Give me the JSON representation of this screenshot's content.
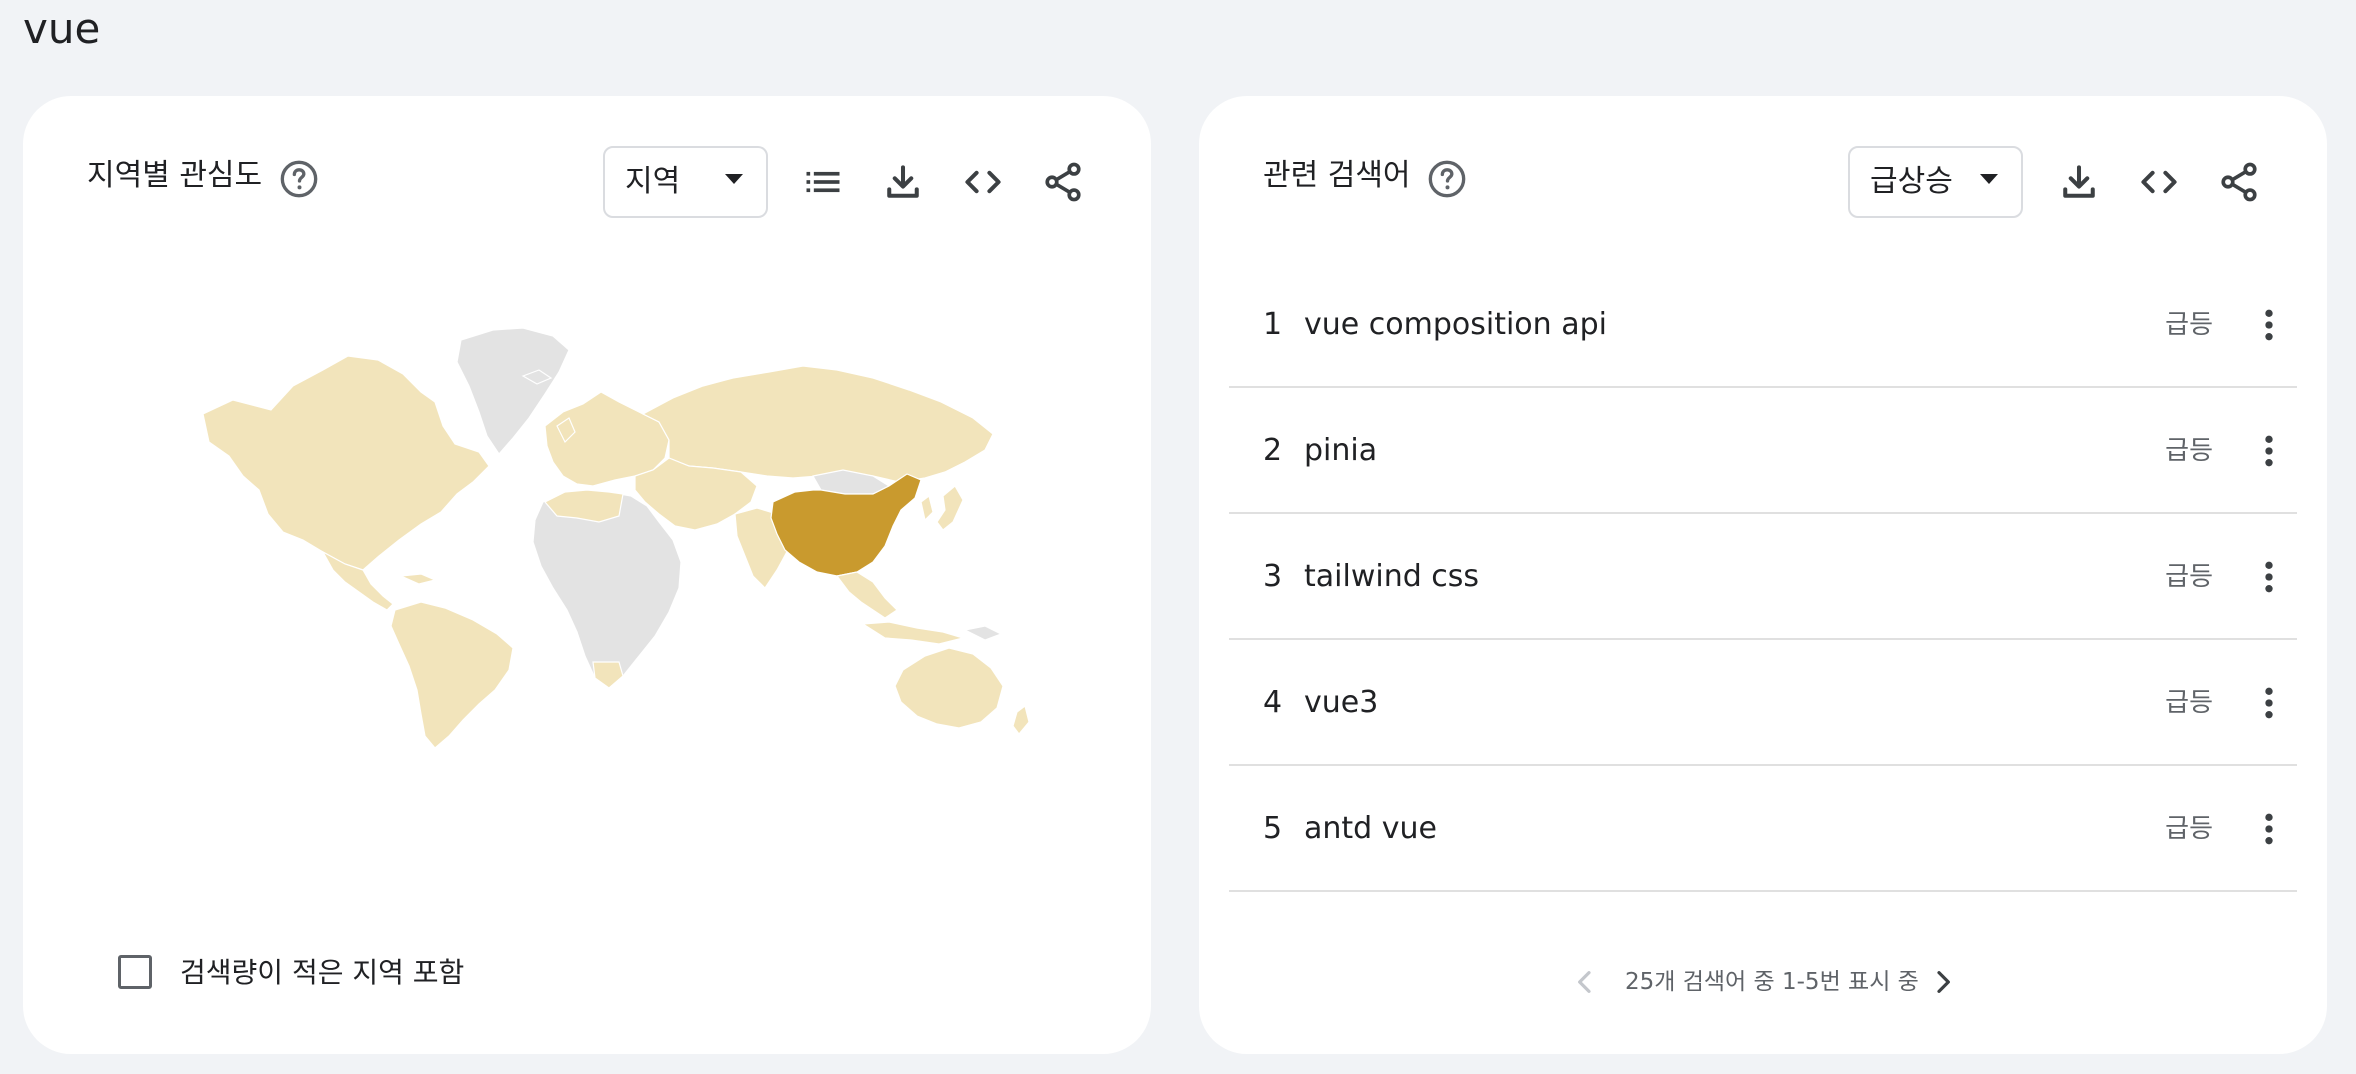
{
  "page": {
    "title": "vue"
  },
  "region_card": {
    "title": "지역별 관심도",
    "dropdown_value": "지역",
    "include_low_volume_label": "검색량이 적은 지역 포함",
    "include_low_volume_checked": false,
    "map": {
      "highlight_color": "#c99a2e",
      "data_color": "#f2e4bb",
      "no_data_color": "#e3e3e3",
      "highlighted_region_icon": "china-region"
    }
  },
  "related_card": {
    "title": "관련 검색어",
    "dropdown_value": "급상승",
    "rows": [
      {
        "rank": "1",
        "term": "vue composition api",
        "trend": "급등"
      },
      {
        "rank": "2",
        "term": "pinia",
        "trend": "급등"
      },
      {
        "rank": "3",
        "term": "tailwind css",
        "trend": "급등"
      },
      {
        "rank": "4",
        "term": "vue3",
        "trend": "급등"
      },
      {
        "rank": "5",
        "term": "antd vue",
        "trend": "급등"
      }
    ],
    "pager_text": "25개 검색어 중 1-5번 표시 중"
  },
  "icons": {
    "help": "help-circle-icon",
    "list": "list-icon",
    "download": "download-icon",
    "embed": "code-icon",
    "share": "share-icon",
    "more": "more-vertical-icon",
    "prev": "chevron-left-icon",
    "next": "chevron-right-icon",
    "caret": "caret-down-icon"
  }
}
